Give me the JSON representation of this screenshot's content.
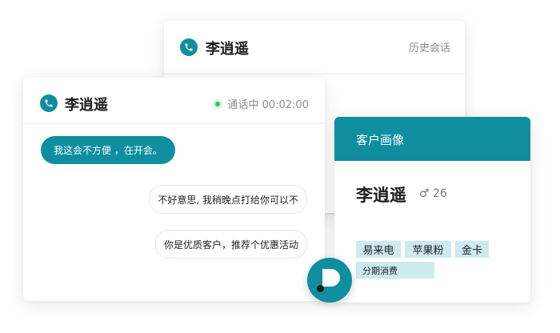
{
  "back_card": {
    "contact_name": "李逍遥",
    "history_label": "历史会话"
  },
  "chat_card": {
    "contact_name": "李逍遥",
    "call_status": "通话中 00:02:00",
    "messages": [
      {
        "direction": "in",
        "text": "我这会不方便 ，在开会。"
      },
      {
        "direction": "out",
        "text": "不好意思, 我稍晚点打给你可以不"
      },
      {
        "direction": "out",
        "text": "你是优质客户，推荐个优惠活动"
      }
    ]
  },
  "profile_card": {
    "title": "客户画像",
    "name": "李逍遥",
    "gender_symbol": "♂",
    "age": "26",
    "tags": [
      "易来电",
      "苹果粉",
      "金卡",
      "分期消费"
    ]
  },
  "colors": {
    "accent": "#0f8ea0",
    "tag_bg": "#cdeaf0",
    "status_green": "#34c759"
  }
}
